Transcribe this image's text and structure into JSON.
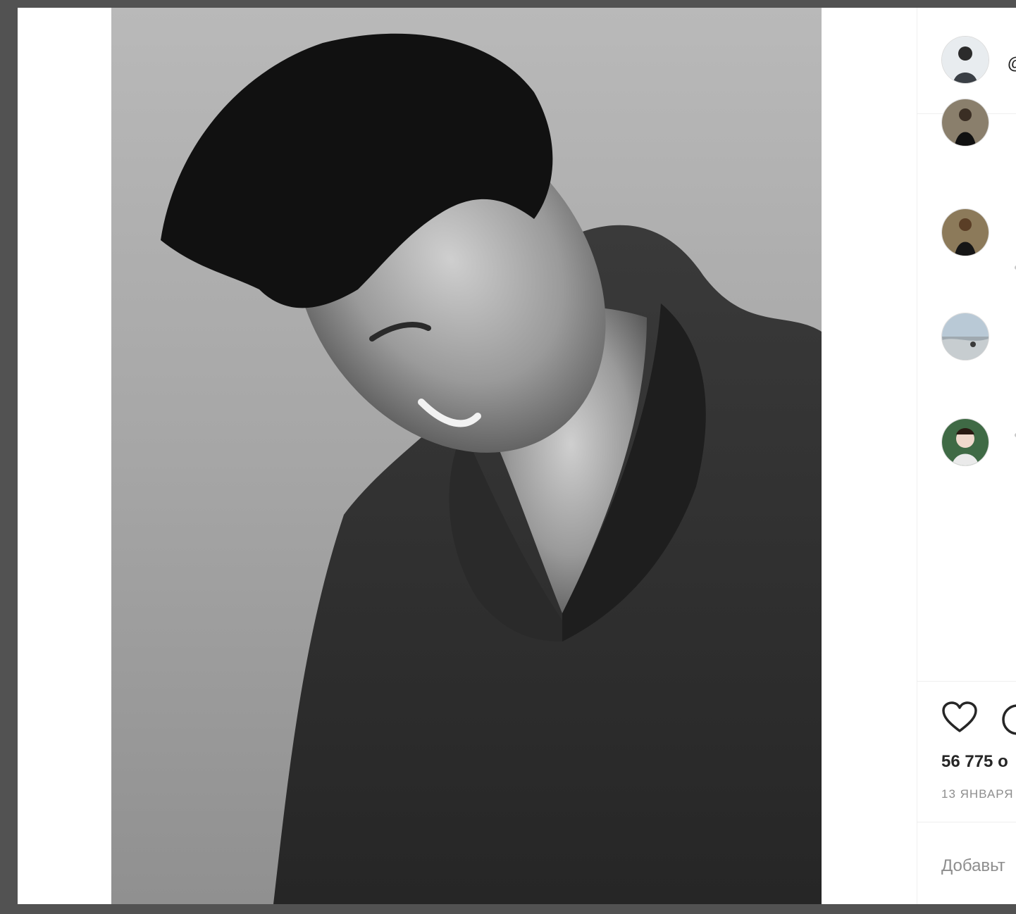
{
  "post": {
    "username": "@",
    "likes_text": "56 775 о",
    "date_text": "13 ЯНВАРЯ",
    "comment_placeholder": "Добавьт"
  },
  "icons": {
    "like": "heart-icon",
    "comment": "speech-bubble-icon"
  },
  "comments": [
    {
      "avatar": "commenter-avatar"
    },
    {
      "avatar": "commenter-avatar"
    },
    {
      "avatar": "commenter-avatar"
    },
    {
      "avatar": "commenter-avatar"
    }
  ],
  "colors": {
    "text_primary": "#262626",
    "text_secondary": "#8e8e8e",
    "divider": "#efefef",
    "page_bg": "#525252"
  }
}
